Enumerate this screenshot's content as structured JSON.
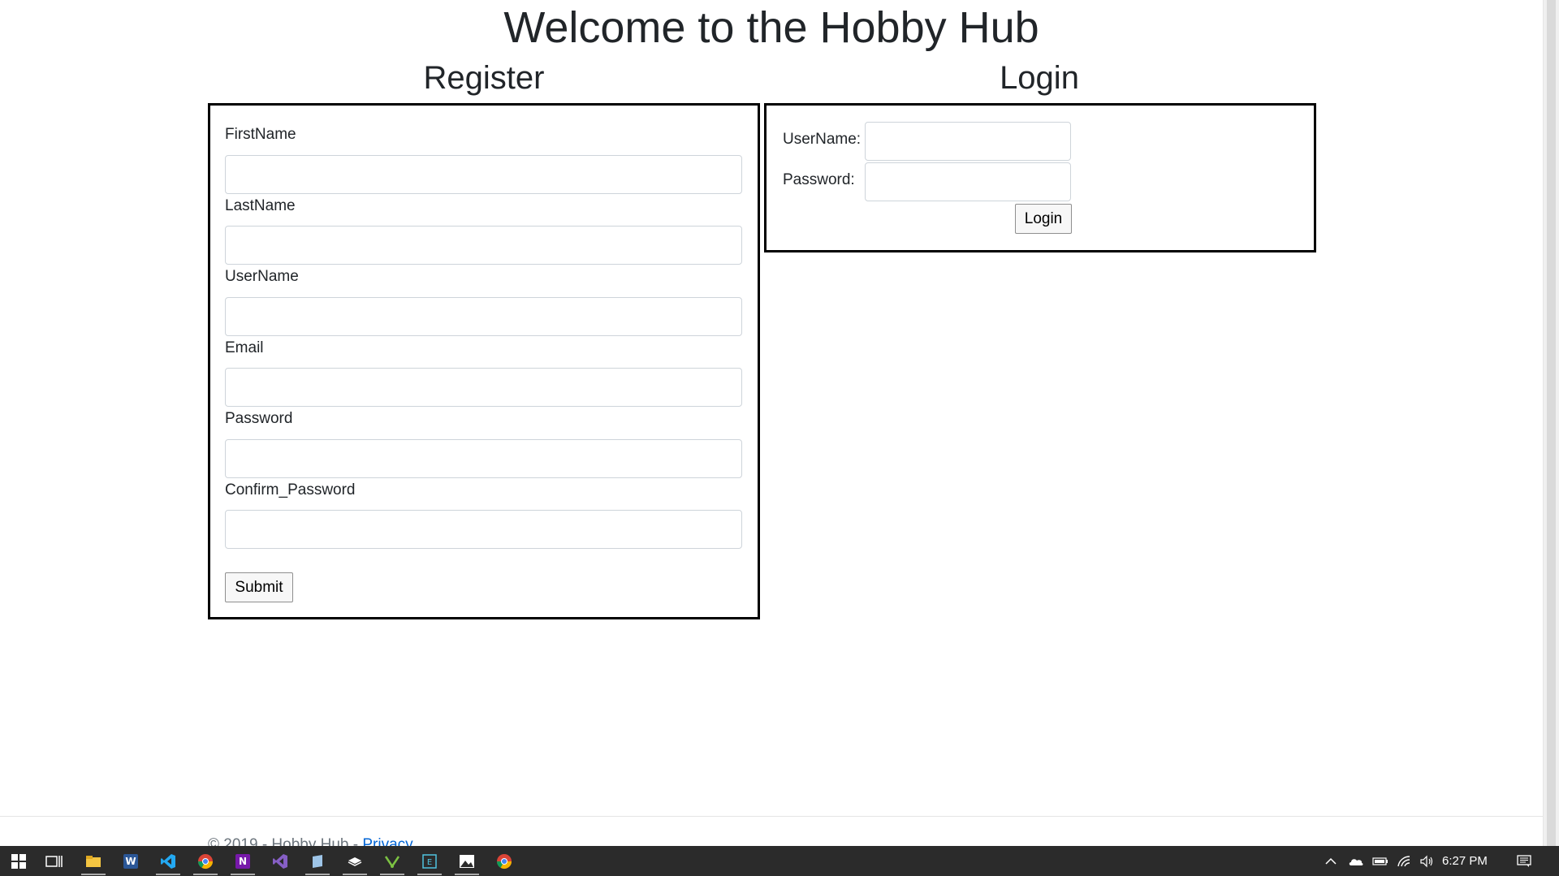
{
  "page": {
    "title": "Welcome to the Hobby Hub"
  },
  "register": {
    "title": "Register",
    "fields": [
      {
        "label": "FirstName",
        "value": ""
      },
      {
        "label": "LastName",
        "value": ""
      },
      {
        "label": "UserName",
        "value": ""
      },
      {
        "label": "Email",
        "value": ""
      },
      {
        "label": "Password",
        "value": ""
      },
      {
        "label": "Confirm_Password",
        "value": ""
      }
    ],
    "submit_label": "Submit"
  },
  "login": {
    "title": "Login",
    "username_label": "UserName:",
    "username_value": "",
    "password_label": "Password:",
    "password_value": "",
    "button_label": "Login"
  },
  "footer": {
    "text": "© 2019 - Hobby Hub - ",
    "privacy_link": "Privacy"
  },
  "taskbar": {
    "apps": [
      {
        "name": "start-icon"
      },
      {
        "name": "task-view-icon"
      },
      {
        "name": "file-explorer-icon"
      },
      {
        "name": "word-icon"
      },
      {
        "name": "vscode-icon"
      },
      {
        "name": "chrome-icon"
      },
      {
        "name": "onenote-icon"
      },
      {
        "name": "visual-studio-icon"
      },
      {
        "name": "app-icon"
      },
      {
        "name": "app-icon"
      },
      {
        "name": "app-icon"
      },
      {
        "name": "app-icon"
      },
      {
        "name": "photos-icon"
      },
      {
        "name": "chrome-icon"
      }
    ],
    "clock": "6:27 PM"
  },
  "colors": {
    "taskbar_bg": "#2b2b2b",
    "panel_border": "#000000",
    "link": "#0366d6"
  }
}
